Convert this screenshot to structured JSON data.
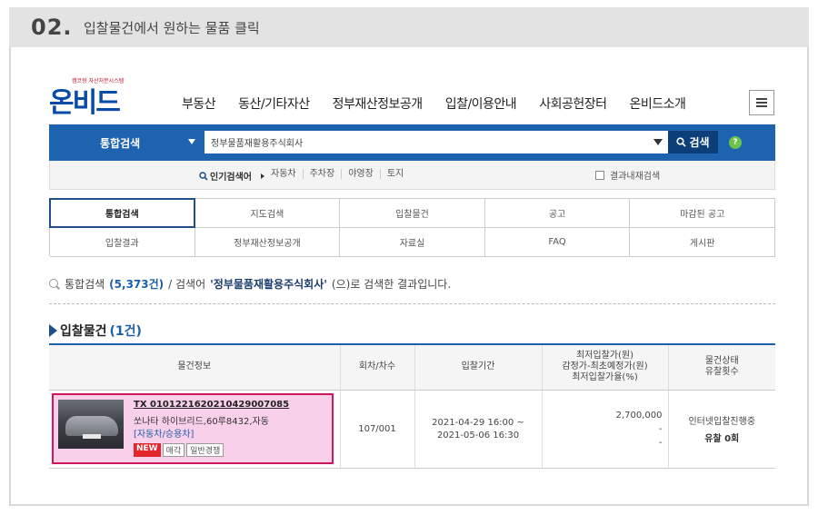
{
  "step": {
    "number": "02.",
    "title": "입찰물건에서 원하는 물품 클릭"
  },
  "brand": {
    "logo_text": "온비드",
    "logo_sub": "캠코형 자산처분시스템"
  },
  "gnb": {
    "items": [
      "부동산",
      "동산/기타자산",
      "정부재산정보공개",
      "입찰/이용안내",
      "사회공헌장터",
      "온비드소개"
    ]
  },
  "search": {
    "category": "통합검색",
    "query": "정부물품재활용주식회사",
    "button": "검색",
    "help": "?"
  },
  "popular": {
    "label": "인기검색어",
    "items": [
      "자동차",
      "주차장",
      "야영장",
      "토지"
    ],
    "in_result": "결과내재검색"
  },
  "tabs": {
    "row1": [
      "통합검색",
      "지도검색",
      "입찰물건",
      "공고",
      "마감된 공고"
    ],
    "row2": [
      "입찰결과",
      "정부재산정보공개",
      "자료실",
      "FAQ",
      "게시판"
    ]
  },
  "result": {
    "prefix": "통합검색",
    "count": "(5,373건)",
    "mid": "/ 검색어",
    "keyword": "'정부물품재활용주식회사'",
    "suffix": "(으)로 검색한 결과입니다."
  },
  "section": {
    "title": "입찰물건",
    "count": "(1건)"
  },
  "table": {
    "headers": {
      "info": "물건정보",
      "round": "회차/차수",
      "period": "입찰기간",
      "price_1": "최저입찰가(원)",
      "price_2": "감정가-최초예정가(원)",
      "price_3": "최저입찰가율(%)",
      "status_1": "물건상태",
      "status_2": "유찰횟수"
    },
    "row": {
      "item_no": "TX 010122162021042900 7085",
      "item_no_clean": "TX 0101221620210429007085",
      "name": "쏘나타 하이브리드,60루8432,자동",
      "category": "[자동차/승용차]",
      "badge_new": "NEW",
      "badge_sale": "매각",
      "badge_type": "일반경쟁",
      "round": "107/001",
      "period_start": "2021-04-29 16:00 ~",
      "period_end": "2021-05-06 16:30",
      "price": "2,700,000",
      "price_dash_1": "-",
      "price_dash_2": "-",
      "status": "인터넷입찰진행중",
      "failures": "유찰 0회"
    }
  }
}
